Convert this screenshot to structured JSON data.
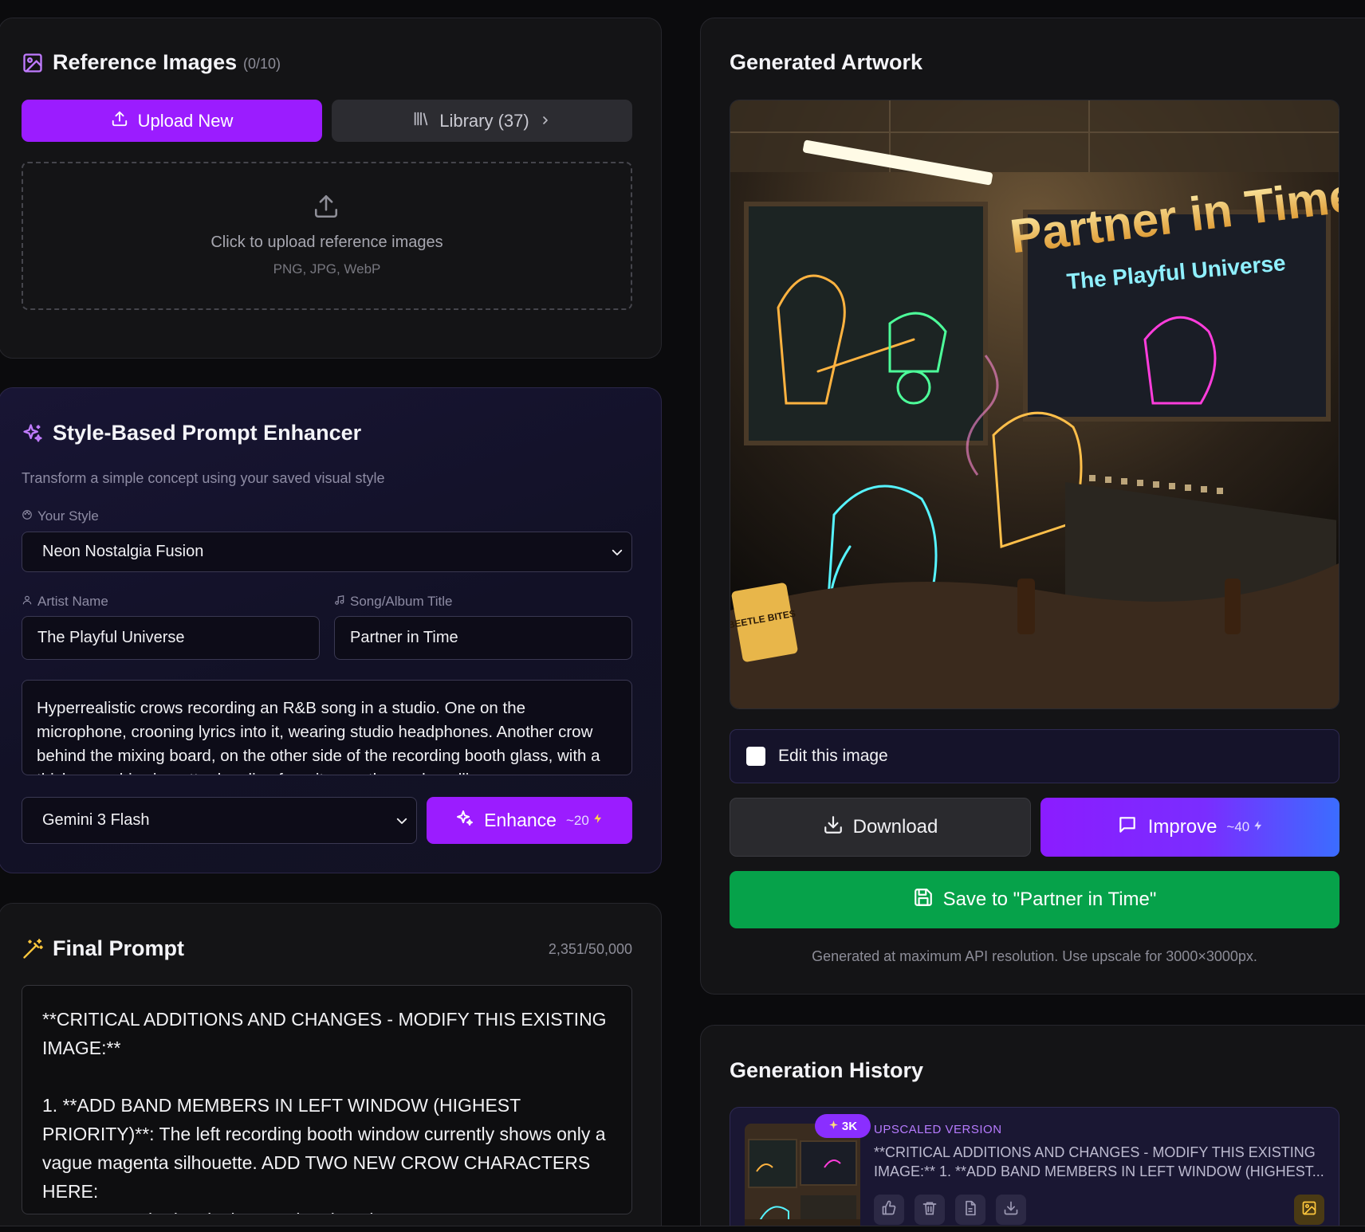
{
  "reference": {
    "title": "Reference Images",
    "count": "(0/10)",
    "upload_label": "Upload New",
    "library_label": "Library (37)",
    "drop_title": "Click to upload reference images",
    "drop_formats": "PNG, JPG, WebP"
  },
  "enhancer": {
    "title": "Style-Based Prompt Enhancer",
    "subtitle": "Transform a simple concept using your saved visual style",
    "style_label": "Your Style",
    "style_value": "Neon Nostalgia Fusion",
    "artist_label": "Artist Name",
    "artist_value": "The Playful Universe",
    "song_label": "Song/Album Title",
    "song_value": "Partner in Time",
    "concept": "Hyperrealistic crows recording an R&B song in a studio. One on the microphone, crooning lyrics into it, wearing studio headphones.  Another crow behind the mixing board, on the other side of the recording booth glass, with a thick cannabis cigarette dangling from its mouth, smoke rolling",
    "model_value": "Gemini 3 Flash",
    "enhance_label": "Enhance",
    "enhance_cost": "~20"
  },
  "final_prompt": {
    "title": "Final Prompt",
    "counter": "2,351/50,000",
    "text": "**CRITICAL ADDITIONS AND CHANGES - MODIFY THIS EXISTING IMAGE:**\n\n1. **ADD BAND MEMBERS IN LEFT WINDOW (HIGHEST PRIORITY)**: The left recording booth window currently shows only a vague magenta silhouette. ADD TWO NEW CROW CHARACTERS HERE:\n   - A crow guitarist playing an electric guitar"
  },
  "artwork": {
    "title": "Generated Artwork",
    "art_title": "Partner in Time",
    "art_subtitle": "The Playful Universe",
    "bag_text": "BEETLE BITES",
    "edit_label": "Edit this image",
    "download_label": "Download",
    "improve_label": "Improve",
    "improve_cost": "~40",
    "save_label": "Save to \"Partner in Time\"",
    "note": "Generated at maximum API resolution. Use upscale for 3000×3000px."
  },
  "history": {
    "title": "Generation History",
    "badge": "3K",
    "tag": "UPSCALED VERSION",
    "line1": "**CRITICAL ADDITIONS AND CHANGES - MODIFY THIS EXISTING",
    "line2": "IMAGE:** 1. **ADD BAND MEMBERS IN LEFT WINDOW (HIGHEST..."
  },
  "colors": {
    "accent_purple": "#9b1cff",
    "save_green": "#06a24a",
    "upscaled_tag": "#b77bff"
  }
}
